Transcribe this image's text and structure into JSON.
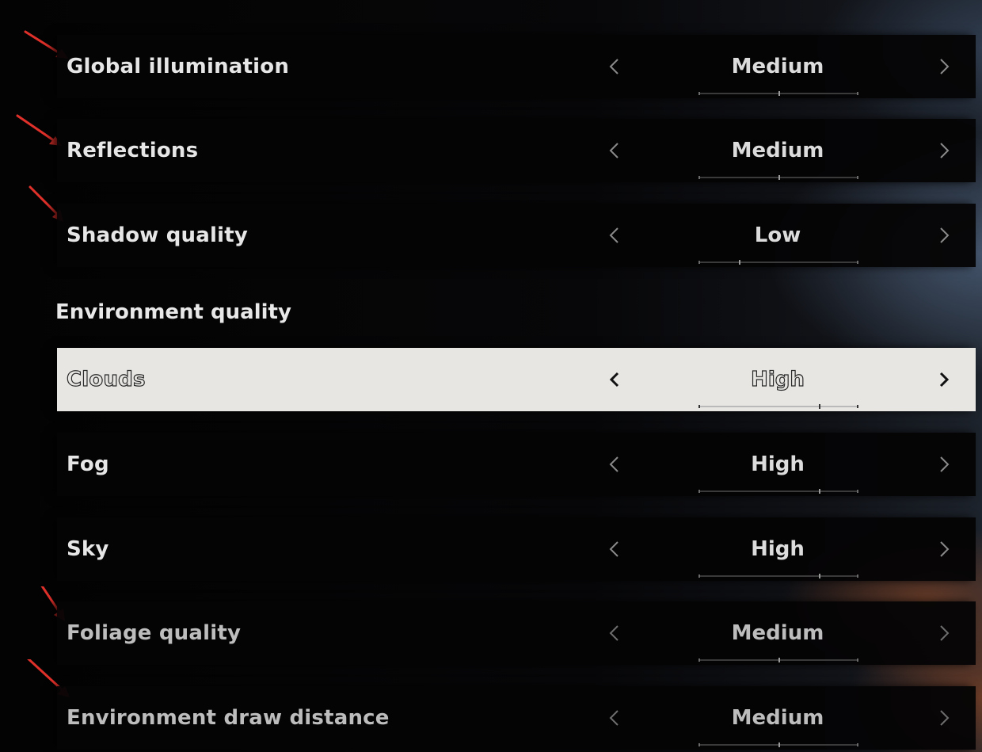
{
  "settings": [
    {
      "label": "Global illumination",
      "value": "Medium",
      "level": 2,
      "levels": 3
    },
    {
      "label": "Reflections",
      "value": "Medium",
      "level": 2,
      "levels": 3
    },
    {
      "label": "Shadow quality",
      "value": "Low",
      "level": 1,
      "levels": 3
    }
  ],
  "section": {
    "title": "Environment quality"
  },
  "environment": [
    {
      "label": "Clouds",
      "value": "High",
      "level": 3,
      "levels": 3,
      "selected": true
    },
    {
      "label": "Fog",
      "value": "High",
      "level": 3,
      "levels": 3
    },
    {
      "label": "Sky",
      "value": "High",
      "level": 3,
      "levels": 3
    },
    {
      "label": "Foliage quality",
      "value": "Medium",
      "level": 2,
      "levels": 3
    },
    {
      "label": "Environment draw distance",
      "value": "Medium",
      "level": 2,
      "levels": 3
    }
  ],
  "icons": {
    "prev": "chevron-left-icon",
    "next": "chevron-right-icon",
    "annotation": "red-arrow-annotation"
  },
  "colors": {
    "annotation_red": "#e0302a",
    "selected_row": "#e7e6e3",
    "row_bg": "#050405"
  }
}
